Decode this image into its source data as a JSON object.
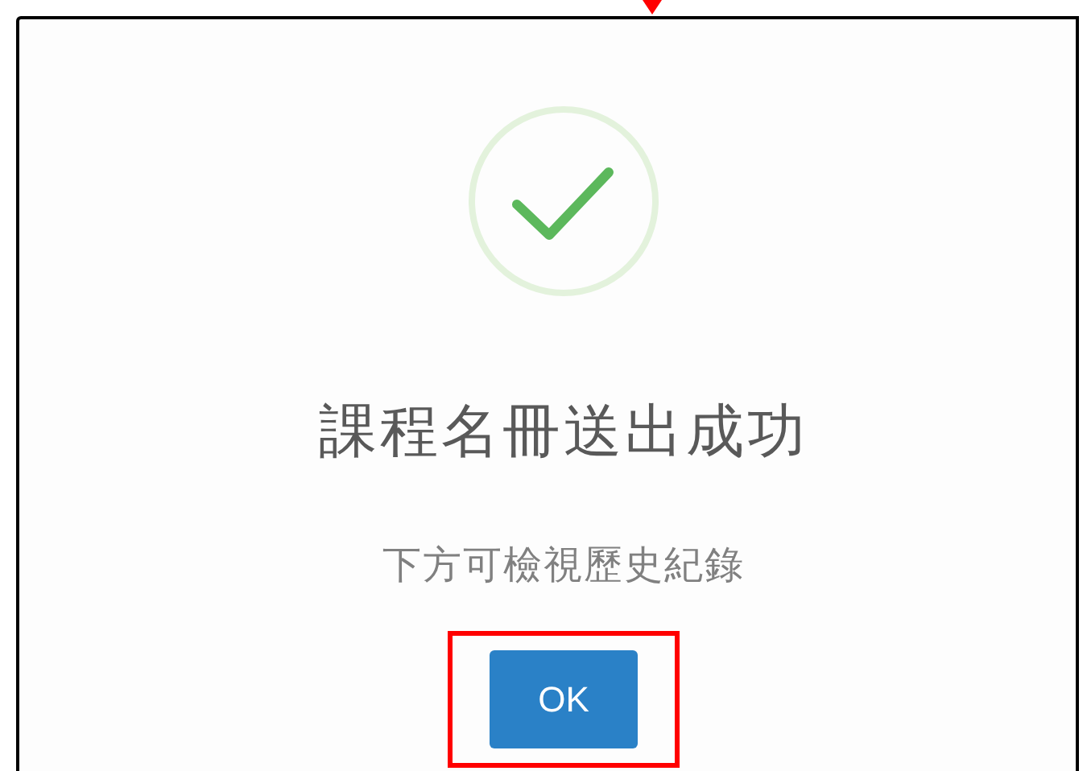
{
  "dialog": {
    "title": "課程名冊送出成功",
    "message": "下方可檢視歷史紀錄",
    "buttons": [
      "OK"
    ]
  }
}
